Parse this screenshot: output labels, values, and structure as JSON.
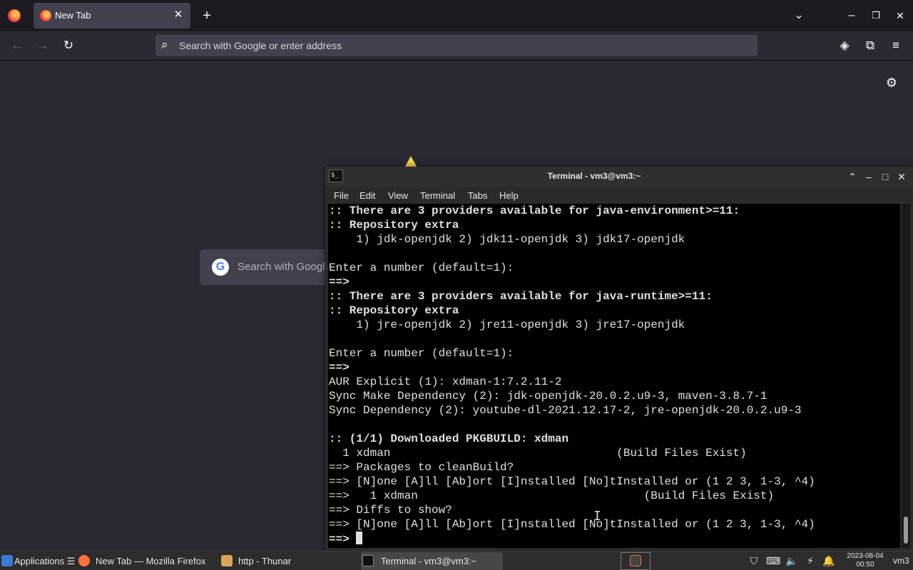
{
  "browser": {
    "tab_title": "New Tab",
    "tab_close": "✕",
    "new_tab": "+",
    "list_tabs": "⌄",
    "minimize": "–",
    "restore": "❐",
    "close": "✕",
    "back": "←",
    "forward": "→",
    "reload": "↻",
    "url_placeholder": "Search with Google or enter address",
    "search_icon": "⌕",
    "pocket_icon": "◈",
    "extensions_icon": "⧉",
    "menu_icon": "≡",
    "settings_icon": "⚙",
    "google_search_text": "Search with Googl",
    "google_logo": "G"
  },
  "terminal": {
    "title": "Terminal - vm3@vm3:~",
    "icon_text": "$_",
    "menu": [
      "File",
      "Edit",
      "View",
      "Terminal",
      "Tabs",
      "Help"
    ],
    "lines": [
      {
        "text": ":: There are 3 providers available for java-environment>=11:",
        "bold": true
      },
      {
        "text": ":: Repository extra",
        "bold": true
      },
      {
        "text": "    1) jdk-openjdk 2) jdk11-openjdk 3) jdk17-openjdk",
        "bold": false
      },
      {
        "text": "",
        "bold": false
      },
      {
        "text": "Enter a number (default=1):",
        "bold": false
      },
      {
        "text": "==>",
        "bold": true
      },
      {
        "text": ":: There are 3 providers available for java-runtime>=11:",
        "bold": true
      },
      {
        "text": ":: Repository extra",
        "bold": true
      },
      {
        "text": "    1) jre-openjdk 2) jre11-openjdk 3) jre17-openjdk",
        "bold": false
      },
      {
        "text": "",
        "bold": false
      },
      {
        "text": "Enter a number (default=1):",
        "bold": false
      },
      {
        "text": "==>",
        "bold": true
      },
      {
        "text": "AUR Explicit (1): xdman-1:7.2.11-2",
        "bold": false
      },
      {
        "text": "Sync Make Dependency (2): jdk-openjdk-20.0.2.u9-3, maven-3.8.7-1",
        "bold": false
      },
      {
        "text": "Sync Dependency (2): youtube-dl-2021.12.17-2, jre-openjdk-20.0.2.u9-3",
        "bold": false
      },
      {
        "text": "",
        "bold": false
      },
      {
        "text": ":: (1/1) Downloaded PKGBUILD: xdman",
        "bold": true
      },
      {
        "text": "  1 xdman                                 (Build Files Exist)",
        "bold": false
      },
      {
        "text": "==> Packages to cleanBuild?",
        "bold": false
      },
      {
        "text": "==> [N]one [A]ll [Ab]ort [I]nstalled [No]tInstalled or (1 2 3, 1-3, ^4)",
        "bold": false
      },
      {
        "text": "==>   1 xdman                                 (Build Files Exist)",
        "bold": false
      },
      {
        "text": "==> Diffs to show?",
        "bold": false
      },
      {
        "text": "==> [N]one [A]ll [Ab]ort [I]nstalled [No]tInstalled or (1 2 3, 1-3, ^4)",
        "bold": false
      }
    ],
    "prompt": "==> ",
    "window_buttons": {
      "shade": "⌃",
      "minimize": "–",
      "maximize": "□",
      "close": "✕"
    }
  },
  "taskbar": {
    "applications": "Applications ☰",
    "tasks": [
      {
        "label": "New Tab — Mozilla Firefox",
        "active": false,
        "color": "#ff7139"
      },
      {
        "label": "http - Thunar",
        "active": false,
        "color": "#d8a657"
      },
      {
        "label": "Terminal - vm3@vm3:~",
        "active": true,
        "color": "#333333"
      }
    ],
    "tray_icons": [
      "shield",
      "keyboard",
      "volume",
      "power",
      "bell"
    ],
    "tray_glyphs": {
      "shield": "⛉",
      "keyboard": "⌨",
      "volume": "🔈",
      "power": "⚡",
      "bell": "🔔"
    },
    "clock_date": "2023-08-04",
    "clock_time": "00:50",
    "user": "vm3"
  }
}
